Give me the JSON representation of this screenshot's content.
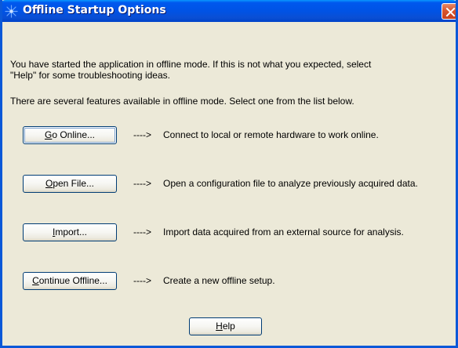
{
  "window": {
    "title": "Offline Startup Options",
    "title_icon": "agilent-spark-icon",
    "close_icon": "close-icon"
  },
  "intro": {
    "line1": "You have started the application in offline mode. If this is not what you expected, select",
    "line2": "\"Help\" for some troubleshooting ideas.",
    "line3": "There are several features available in offline mode. Select one from the list below."
  },
  "options": [
    {
      "button_mnemonic": "G",
      "button_rest": "o Online...",
      "arrow": "---->",
      "description": "Connect to local or remote hardware to work online."
    },
    {
      "button_mnemonic": "O",
      "button_rest": "pen File...",
      "arrow": "---->",
      "description": "Open a configuration file to analyze previously acquired data."
    },
    {
      "button_mnemonic": "I",
      "button_rest": "mport...",
      "arrow": "---->",
      "description": "Import data acquired from an external source for analysis."
    },
    {
      "button_mnemonic": "C",
      "button_rest": "ontinue Offline...",
      "arrow": "---->",
      "description": "Create a new offline setup."
    }
  ],
  "help": {
    "button_mnemonic": "H",
    "button_rest": "elp"
  },
  "colors": {
    "titlebar": "#0053e5",
    "dialog_bg": "#ece9d8",
    "close_button": "#d9552e",
    "button_border": "#003c74"
  }
}
